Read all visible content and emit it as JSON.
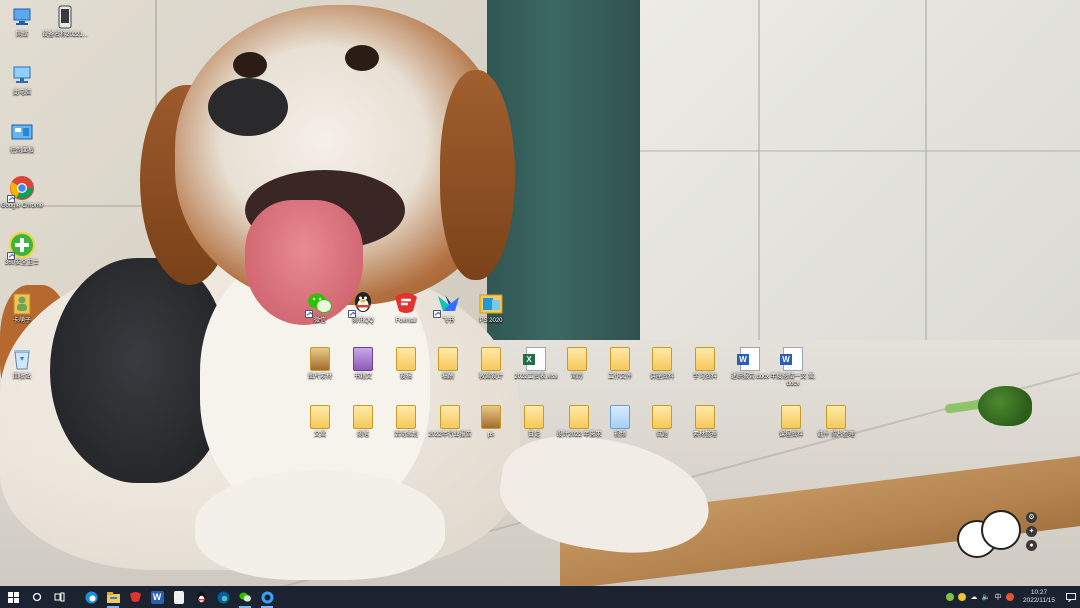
{
  "desktop": {
    "left_column": [
      {
        "label": "网络",
        "icon": "network-icon"
      },
      {
        "label": "此电脑",
        "icon": "computer-icon"
      },
      {
        "label": "控制面板",
        "icon": "control-panel-icon"
      },
      {
        "label": "Google Chrome",
        "icon": "chrome-icon"
      },
      {
        "label": "360安全卫士",
        "icon": "security-guard-icon"
      },
      {
        "label": "卡萌子",
        "icon": "user-folder-icon"
      },
      {
        "label": "回收站",
        "icon": "recycle-bin-icon"
      }
    ],
    "top_file": {
      "label": "设备名称20221...",
      "icon": "phone-file-icon"
    },
    "app_row": [
      {
        "label": "微信",
        "icon": "wechat-icon"
      },
      {
        "label": "腾讯QQ",
        "icon": "qq-icon"
      },
      {
        "label": "Foxmail",
        "icon": "foxmail-icon"
      },
      {
        "label": "飞书",
        "icon": "feishu-icon"
      },
      {
        "label": "PS 2020",
        "icon": "ps-folder-icon"
      }
    ],
    "file_row_1": [
      {
        "label": "图片素材",
        "icon": "folder-icon"
      },
      {
        "label": "书籍文",
        "icon": "folder-icon"
      },
      {
        "label": "投稿",
        "icon": "folder-icon"
      },
      {
        "label": "稿酬",
        "icon": "folder-icon"
      },
      {
        "label": "教案设计",
        "icon": "folder-icon"
      },
      {
        "label": "2022工资表.xlsx",
        "icon": "excel-icon"
      },
      {
        "label": "简历",
        "icon": "folder-icon"
      },
      {
        "label": "工作文件",
        "icon": "folder-icon"
      },
      {
        "label": "讲座资料",
        "icon": "folder-icon"
      },
      {
        "label": "学习资料",
        "icon": "folder-icon"
      },
      {
        "label": "述职报告.docx",
        "icon": "word-icon"
      },
      {
        "label": "年度总结一文 案.docx",
        "icon": "word-icon"
      }
    ],
    "file_row_2": [
      {
        "label": "文案",
        "icon": "folder-icon"
      },
      {
        "label": "随笔",
        "icon": "folder-icon"
      },
      {
        "label": "活动策划",
        "icon": "folder-icon"
      },
      {
        "label": "2022年行业报告",
        "icon": "folder-icon"
      },
      {
        "label": "ps",
        "icon": "folder-icon"
      },
      {
        "label": "日记",
        "icon": "folder-icon"
      },
      {
        "label": "设计2022 年需求",
        "icon": "folder-icon"
      },
      {
        "label": "视频",
        "icon": "folder-icon"
      },
      {
        "label": "试题",
        "icon": "folder-icon"
      },
      {
        "label": "素材整理",
        "icon": "folder-icon"
      },
      {
        "label": "课程资料",
        "icon": "folder-icon"
      },
      {
        "label": "证件 照片整理",
        "icon": "folder-icon"
      }
    ]
  },
  "taskbar": {
    "items": [
      {
        "icon": "windows-start-icon",
        "label": ""
      },
      {
        "icon": "search-icon",
        "label": ""
      },
      {
        "icon": "task-view-icon",
        "label": ""
      },
      {
        "icon": "edge-icon",
        "label": ""
      },
      {
        "icon": "file-explorer-icon",
        "label": ""
      },
      {
        "icon": "foxmail-taskbar-icon",
        "label": ""
      },
      {
        "icon": "word-taskbar-icon",
        "label": "W"
      },
      {
        "icon": "notes-icon",
        "label": ""
      },
      {
        "icon": "qq-taskbar-icon",
        "label": ""
      },
      {
        "icon": "edge-dev-icon",
        "label": ""
      },
      {
        "icon": "wechat-taskbar-icon",
        "label": ""
      },
      {
        "icon": "browser-icon",
        "label": ""
      }
    ],
    "tray": {
      "ime": "中",
      "time": "10:27",
      "date": "2022/11/15"
    }
  },
  "colors": {
    "taskbar": "#1c2330",
    "accent": "#7fb2f0",
    "folder": "#f5c95a"
  }
}
